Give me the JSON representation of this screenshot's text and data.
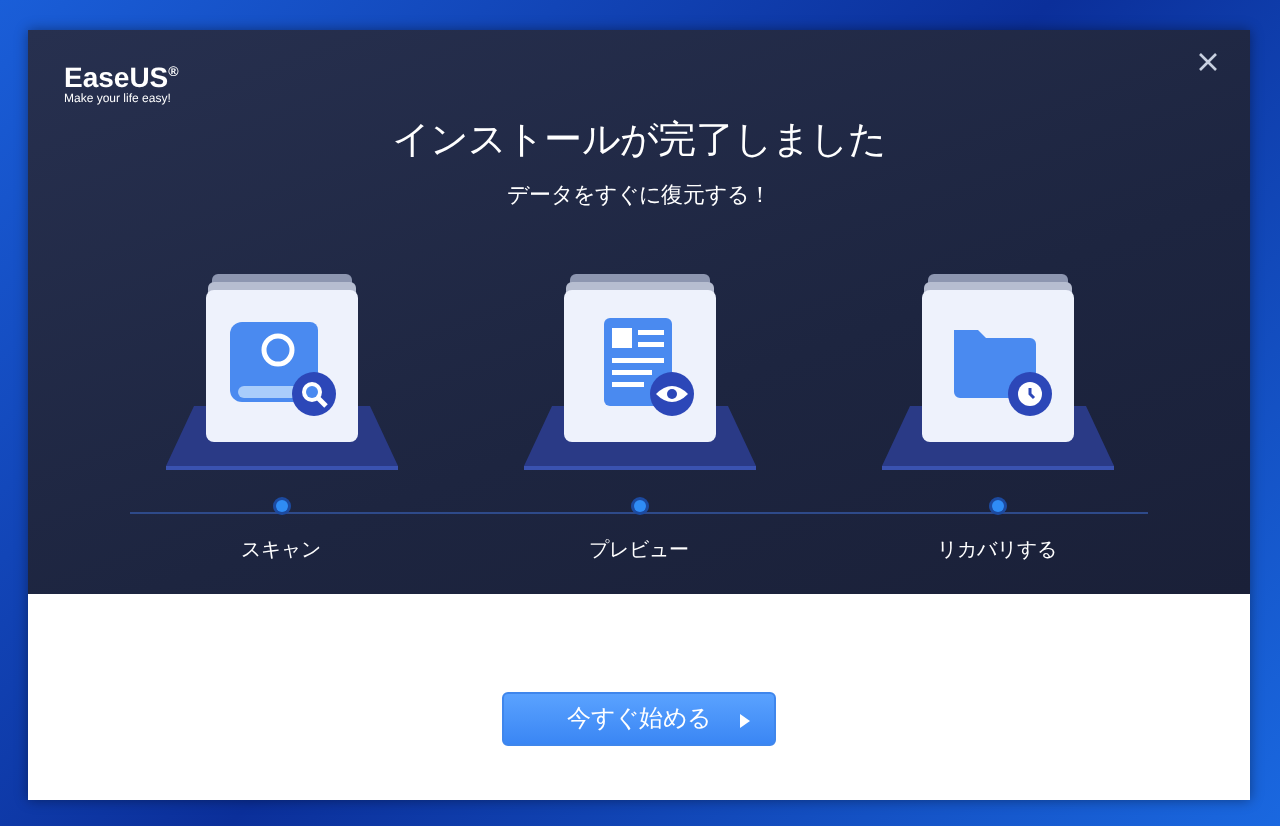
{
  "window": {
    "logo": "EaseUS$^{®}$",
    "tagline": "Make your life easy!",
    "title": "インストールが完了しました",
    "subtitle": "データをすぐに復元する！"
  },
  "steps": [
    {
      "kind": "scan",
      "label": "スキャン"
    },
    {
      "kind": "preview",
      "label": "プレビュー"
    },
    {
      "kind": "recover",
      "label": "リカバリする"
    }
  ],
  "button": {
    "label": "今すぐ始める"
  }
}
